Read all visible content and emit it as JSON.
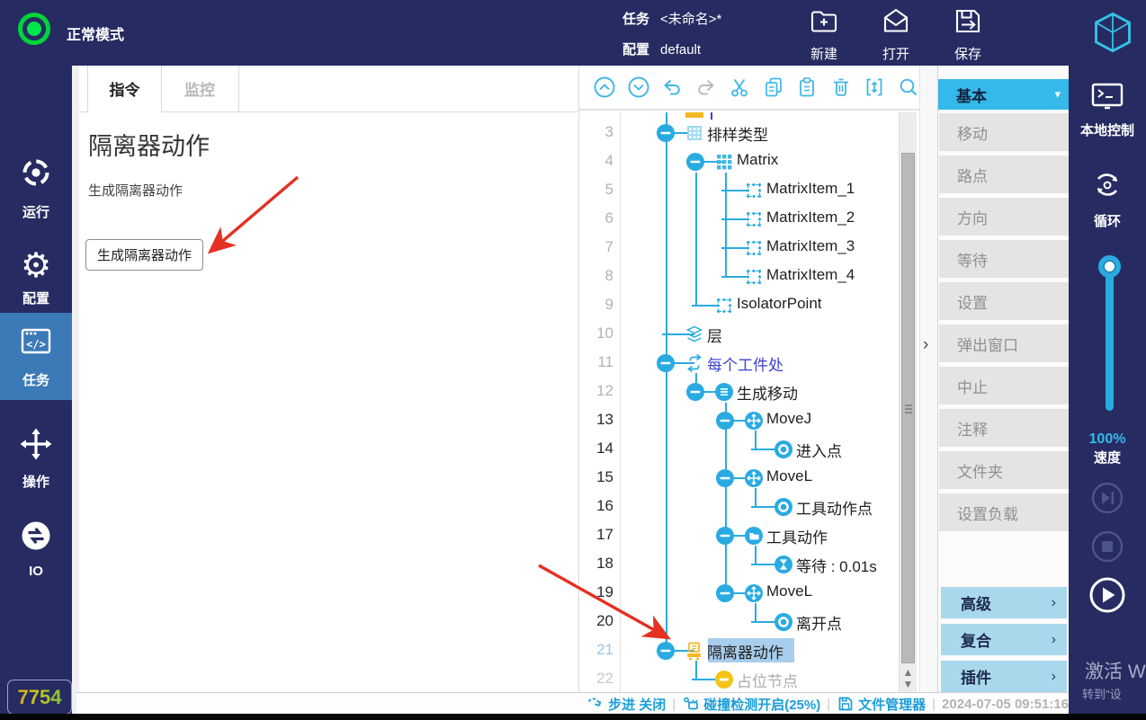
{
  "colors": {
    "navy": "#262c62",
    "accent": "#29abe2",
    "toolbar_blue": "#3fb6e8",
    "nav_active": "#3b7ab6",
    "yellow": "#f2b723",
    "red_arrow": "#e53022",
    "palette_header": "#35b9ea",
    "selected_row": "#a9cdec",
    "status_cyan": "#1b9ed9"
  },
  "topbar": {
    "mode": "正常模式",
    "task_label": "任务",
    "task_value": "<未命名>*",
    "config_label": "配置",
    "config_value": "default",
    "actions": [
      {
        "id": "new",
        "label": "新建"
      },
      {
        "id": "open",
        "label": "打开"
      },
      {
        "id": "save",
        "label": "保存"
      }
    ]
  },
  "sidebar": {
    "badge": "7754",
    "items": [
      {
        "id": "run",
        "label": "运行",
        "active": false
      },
      {
        "id": "config",
        "label": "配置",
        "active": false
      },
      {
        "id": "task",
        "label": "任务",
        "active": true
      },
      {
        "id": "operate",
        "label": "操作",
        "active": false
      },
      {
        "id": "io",
        "label": "IO",
        "active": false
      }
    ]
  },
  "main": {
    "tabs": [
      {
        "label": "指令",
        "active": true
      },
      {
        "label": "监控",
        "active": false
      }
    ],
    "title": "隔离器动作",
    "subtitle": "生成隔离器动作",
    "button": "生成隔离器动作"
  },
  "toolbar": {
    "icons": [
      "collapse-all",
      "expand-all",
      "undo",
      "redo",
      "cut",
      "copy",
      "paste",
      "delete",
      "insert",
      "search"
    ]
  },
  "tree": {
    "rows": [
      {
        "n": 3,
        "label": "排样类型",
        "icon": "pattern",
        "slot": 0,
        "circle": true,
        "num_style": "dim",
        "label_style": "default",
        "selected": false
      },
      {
        "n": 4,
        "label": "Matrix",
        "icon": "matrix",
        "slot": 1,
        "circle": true,
        "num_style": "dim",
        "label_style": "default",
        "selected": false
      },
      {
        "n": 5,
        "label": "MatrixItem_1",
        "icon": "dashed",
        "slot": 2,
        "circle": false,
        "num_style": "dim",
        "label_style": "default",
        "selected": false
      },
      {
        "n": 6,
        "label": "MatrixItem_2",
        "icon": "dashed",
        "slot": 2,
        "circle": false,
        "num_style": "dim",
        "label_style": "default",
        "selected": false
      },
      {
        "n": 7,
        "label": "MatrixItem_3",
        "icon": "dashed",
        "slot": 2,
        "circle": false,
        "num_style": "dim",
        "label_style": "default",
        "selected": false
      },
      {
        "n": 8,
        "label": "MatrixItem_4",
        "icon": "dashed",
        "slot": 2,
        "circle": false,
        "num_style": "dim",
        "label_style": "default",
        "selected": false
      },
      {
        "n": 9,
        "label": "IsolatorPoint",
        "icon": "dashed",
        "slot": 1,
        "circle": false,
        "num_style": "dim",
        "label_style": "default",
        "selected": false
      },
      {
        "n": 10,
        "label": "层",
        "icon": "layers",
        "slot": 0,
        "circle": false,
        "num_style": "dim",
        "label_style": "default",
        "selected": false
      },
      {
        "n": 11,
        "label": "每个工件处",
        "icon": "loop",
        "slot": 0,
        "circle": true,
        "num_style": "dim",
        "label_style": "blue",
        "selected": false
      },
      {
        "n": 12,
        "label": "生成移动",
        "icon": "menu",
        "slot": 1,
        "circle": true,
        "num_style": "dim",
        "label_style": "default",
        "selected": false
      },
      {
        "n": 13,
        "label": "MoveJ",
        "icon": "move",
        "slot": 2,
        "circle": true,
        "num_style": "dark",
        "label_style": "default",
        "selected": false
      },
      {
        "n": 14,
        "label": "进入点",
        "icon": "waypoint",
        "slot": 3,
        "circle": false,
        "num_style": "dark",
        "label_style": "default",
        "selected": false
      },
      {
        "n": 15,
        "label": "MoveL",
        "icon": "move",
        "slot": 2,
        "circle": true,
        "num_style": "dark",
        "label_style": "default",
        "selected": false
      },
      {
        "n": 16,
        "label": "工具动作点",
        "icon": "waypoint",
        "slot": 3,
        "circle": false,
        "num_style": "dark",
        "label_style": "default",
        "selected": false
      },
      {
        "n": 17,
        "label": "工具动作",
        "icon": "folder",
        "slot": 2,
        "circle": true,
        "num_style": "dark",
        "label_style": "default",
        "selected": false
      },
      {
        "n": 18,
        "label": "等待 : 0.01s",
        "icon": "hourglass",
        "slot": 3,
        "circle": false,
        "num_style": "dark",
        "label_style": "default",
        "selected": false
      },
      {
        "n": 19,
        "label": "MoveL",
        "icon": "move",
        "slot": 2,
        "circle": true,
        "num_style": "dark",
        "label_style": "default",
        "selected": false
      },
      {
        "n": 20,
        "label": "离开点",
        "icon": "waypoint",
        "slot": 3,
        "circle": false,
        "num_style": "dark",
        "label_style": "default",
        "selected": false
      },
      {
        "n": 21,
        "label": "隔离器动作",
        "icon": "isolator",
        "slot": 0,
        "circle": true,
        "num_style": "sel",
        "label_style": "default",
        "selected": true
      },
      {
        "n": 22,
        "label": "占位节点",
        "icon": "minus",
        "slot": 1,
        "circle": false,
        "num_style": "faded",
        "label_style": "gray",
        "selected": false
      }
    ]
  },
  "palette": {
    "header": "基本",
    "items": [
      "移动",
      "路点",
      "方向",
      "等待",
      "设置",
      "弹出窗口",
      "中止",
      "注释",
      "文件夹",
      "设置负载"
    ],
    "groups": [
      "高级",
      "复合",
      "插件"
    ]
  },
  "rightbar": {
    "local_label": "本地控制",
    "loop_label": "循环",
    "speed_value": "100%",
    "speed_label": "速度",
    "playback": [
      "skip",
      "stop",
      "play"
    ]
  },
  "statusbar": {
    "segments": [
      {
        "id": "step",
        "label": "步进 关闭"
      },
      {
        "id": "collision",
        "label": "碰撞检测开启(25%)"
      },
      {
        "id": "files",
        "label": "文件管理器"
      }
    ],
    "datetime": "2024-07-05 09:51:16"
  },
  "watermark": {
    "line1": "激活 W",
    "line2": "转到\"设"
  }
}
